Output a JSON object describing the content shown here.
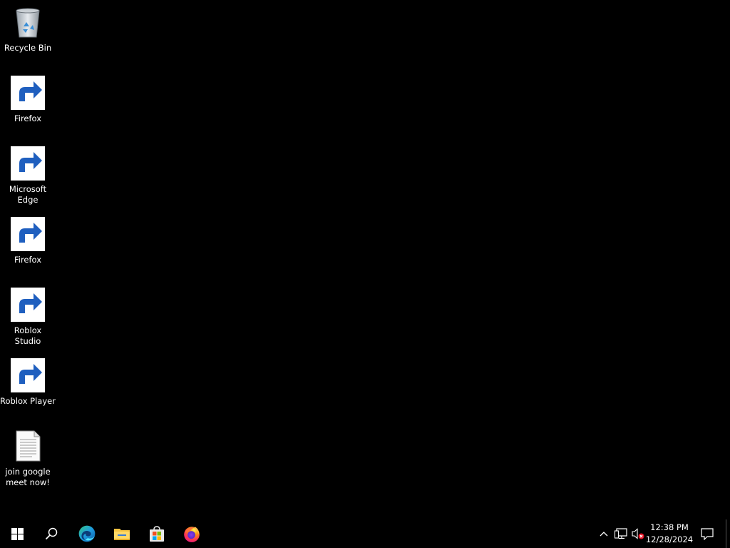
{
  "desktop": {
    "background_color": "#000000",
    "icons": [
      {
        "name": "recycle-bin",
        "icon": "recycle-bin-icon",
        "label": "Recycle Bin",
        "shortcut": false
      },
      {
        "name": "firefox-1",
        "icon": "firefox-icon",
        "label": "Firefox",
        "shortcut": true
      },
      {
        "name": "microsoft-edge",
        "icon": "edge-icon",
        "label": "Microsoft Edge",
        "shortcut": true
      },
      {
        "name": "firefox-2",
        "icon": "firefox-icon",
        "label": "Firefox",
        "shortcut": true
      },
      {
        "name": "roblox-studio",
        "icon": "roblox-studio-icon",
        "label": "Roblox Studio",
        "shortcut": true
      },
      {
        "name": "roblox-player",
        "icon": "roblox-player-icon",
        "label": "Roblox Player",
        "shortcut": true
      },
      {
        "name": "join-google-meet-now",
        "icon": "text-document-icon",
        "label": "join google meet now!",
        "shortcut": false
      }
    ]
  },
  "taskbar": {
    "background_color": "#000000",
    "buttons": [
      {
        "name": "start",
        "icon": "windows-logo-icon"
      },
      {
        "name": "search",
        "icon": "search-icon"
      },
      {
        "name": "edge",
        "icon": "edge-icon"
      },
      {
        "name": "file-explorer",
        "icon": "folder-icon"
      },
      {
        "name": "microsoft-store",
        "icon": "store-icon"
      },
      {
        "name": "firefox",
        "icon": "firefox-icon"
      }
    ],
    "tray": {
      "icons": [
        {
          "name": "show-hidden-icons",
          "icon": "chevron-up-icon"
        },
        {
          "name": "network",
          "icon": "network-icon"
        },
        {
          "name": "volume",
          "icon": "volume-muted-icon"
        }
      ],
      "clock": {
        "time": "12:38 PM",
        "date": "12/28/2024"
      },
      "notifications_icon": "action-center-icon"
    }
  }
}
